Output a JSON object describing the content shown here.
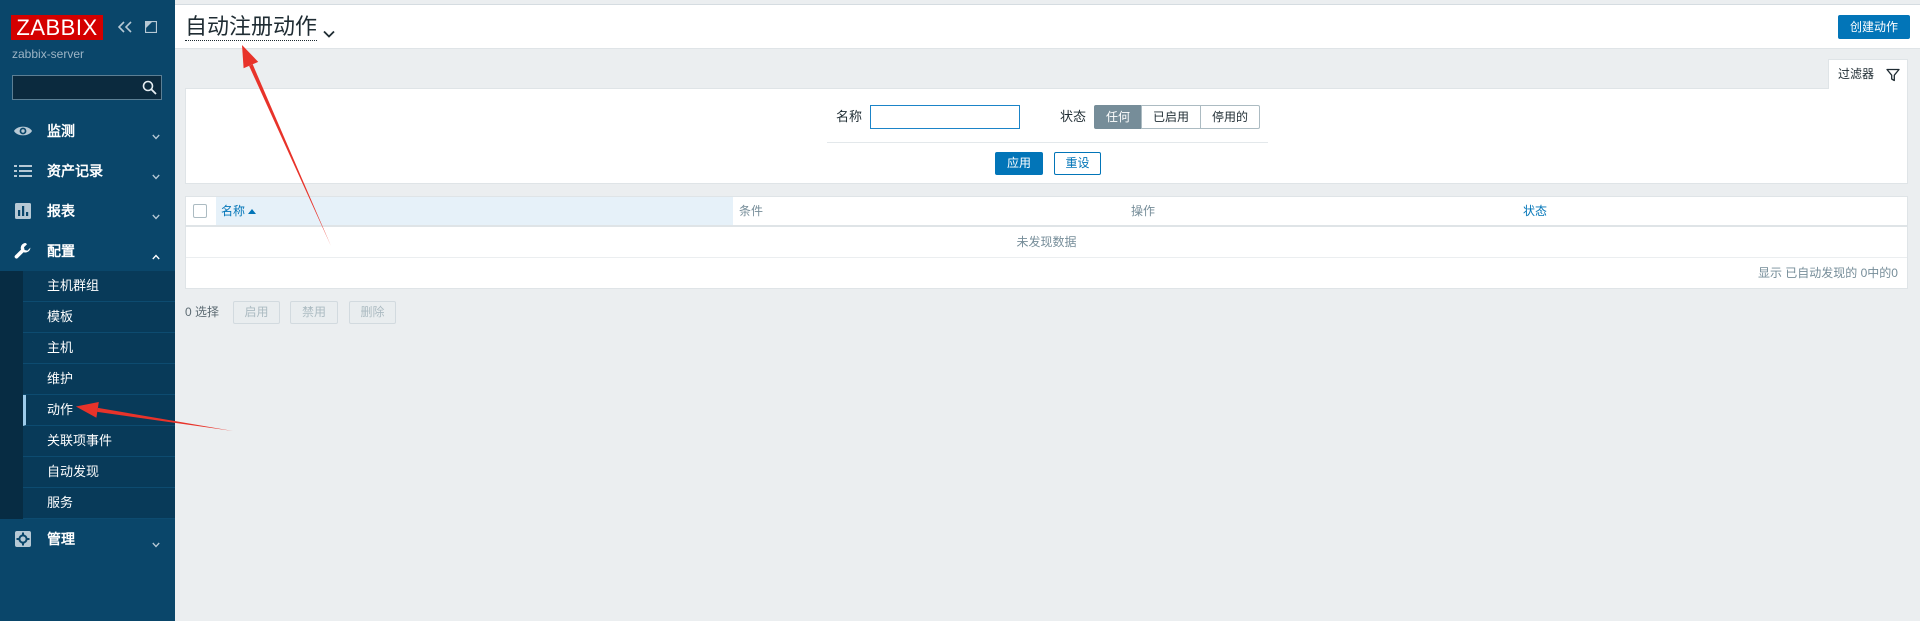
{
  "sidebar": {
    "logo": "ZABBIX",
    "server_name": "zabbix-server",
    "search": {
      "value": "",
      "icon": "search-icon"
    },
    "header_icons": [
      "collapse-sidebar-icon",
      "kiosk-mode-icon"
    ],
    "menu": [
      {
        "label": "监测",
        "icon": "eye-icon",
        "expanded": false
      },
      {
        "label": "资产记录",
        "icon": "list-icon",
        "expanded": false
      },
      {
        "label": "报表",
        "icon": "bar-chart-icon",
        "expanded": false
      },
      {
        "label": "配置",
        "icon": "wrench-icon",
        "expanded": true,
        "items": [
          "主机群组",
          "模板",
          "主机",
          "维护",
          "动作",
          "关联项事件",
          "自动发现",
          "服务"
        ],
        "selected_index": 4
      },
      {
        "label": "管理",
        "icon": "gear-icon",
        "expanded": false
      }
    ]
  },
  "header": {
    "title": "自动注册动作",
    "title_icon": "chevron-down-icon",
    "create_button": "创建动作"
  },
  "filter": {
    "tab_label": "过滤器",
    "tab_icon": "funnel-icon",
    "name_label": "名称",
    "name_value": "",
    "status_label": "状态",
    "status_options": [
      "任何",
      "已启用",
      "停用的"
    ],
    "status_selected_index": 0,
    "apply_button": "应用",
    "reset_button": "重设"
  },
  "table": {
    "columns": [
      "名称",
      "条件",
      "操作",
      "状态"
    ],
    "sort_column_index": 0,
    "sort_ascending": true,
    "rows": [],
    "empty_message": "未发现数据",
    "footer": "显示 已自动发现的 0中的0"
  },
  "bulk_actions": {
    "selected_count": "0 选择",
    "buttons": [
      "启用",
      "禁用",
      "删除"
    ],
    "buttons_disabled": true
  },
  "colors": {
    "brand_red": "#d40000",
    "sidebar_bg": "#0a466a",
    "accent_blue": "#0275b8",
    "page_bg": "#ebeef0",
    "annotation_red": "#e8332a"
  }
}
